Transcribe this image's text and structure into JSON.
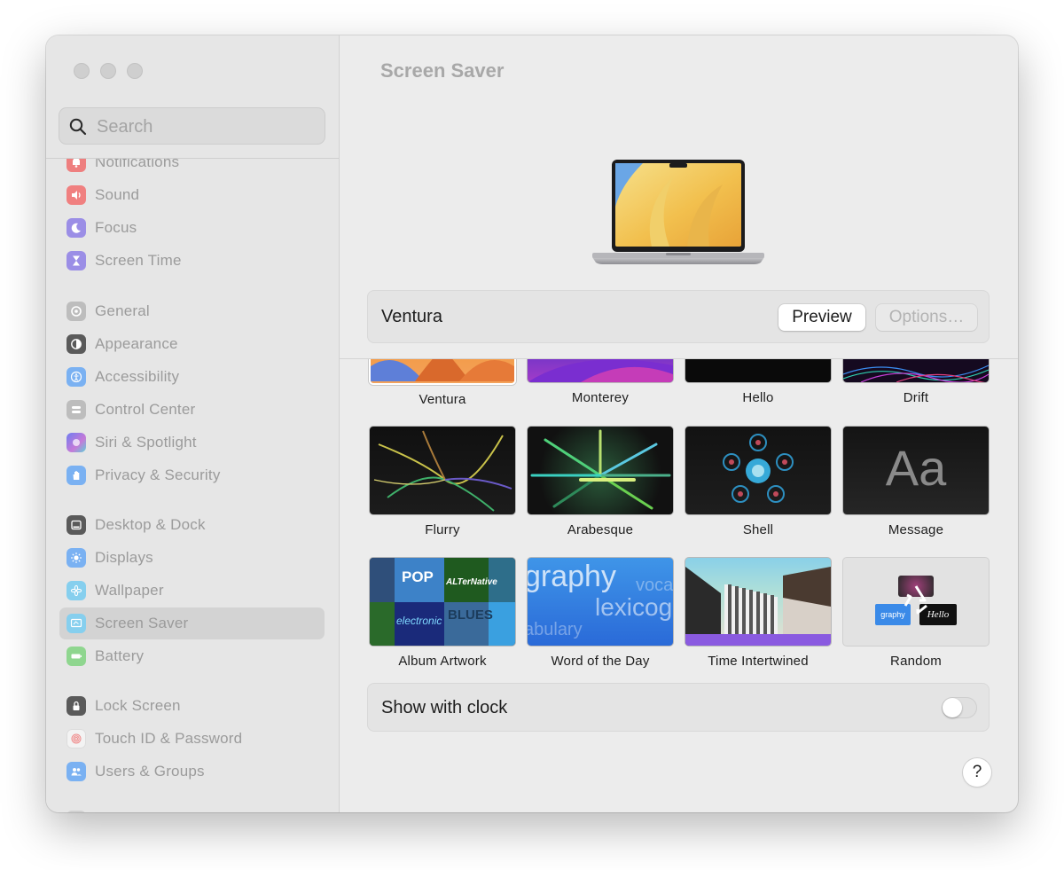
{
  "window": {
    "controls": [
      "close",
      "minimize",
      "zoom"
    ]
  },
  "search": {
    "placeholder": "Search"
  },
  "sidebar": {
    "items": [
      {
        "label": "Notifications",
        "icon": "bell-icon",
        "color": "#ee7f7f"
      },
      {
        "label": "Sound",
        "icon": "speaker-icon",
        "color": "#f08080"
      },
      {
        "label": "Focus",
        "icon": "moon-icon",
        "color": "#9b8ee6"
      },
      {
        "label": "Screen Time",
        "icon": "hourglass-icon",
        "color": "#9b8ee6"
      },
      {
        "label": "General",
        "icon": "gear-icon",
        "color": "#bdbdbd"
      },
      {
        "label": "Appearance",
        "icon": "appearance-icon",
        "color": "#5a5a5a"
      },
      {
        "label": "Accessibility",
        "icon": "accessibility-icon",
        "color": "#7ab1f2"
      },
      {
        "label": "Control Center",
        "icon": "control-center-icon",
        "color": "#bdbdbd"
      },
      {
        "label": "Siri & Spotlight",
        "icon": "siri-icon",
        "color": "#8a7fd6"
      },
      {
        "label": "Privacy & Security",
        "icon": "hand-icon",
        "color": "#7ab1f2"
      },
      {
        "label": "Desktop & Dock",
        "icon": "dock-icon",
        "color": "#5a5a5a"
      },
      {
        "label": "Displays",
        "icon": "sun-icon",
        "color": "#7ab1f2"
      },
      {
        "label": "Wallpaper",
        "icon": "flower-icon",
        "color": "#86cfee"
      },
      {
        "label": "Screen Saver",
        "icon": "screen-saver-icon",
        "color": "#86cfee"
      },
      {
        "label": "Battery",
        "icon": "battery-icon",
        "color": "#8fd68f"
      },
      {
        "label": "Lock Screen",
        "icon": "lock-icon",
        "color": "#5a5a5a"
      },
      {
        "label": "Touch ID & Password",
        "icon": "fingerprint-icon",
        "color": "#f3f3f3"
      },
      {
        "label": "Users & Groups",
        "icon": "users-icon",
        "color": "#7ab1f2"
      }
    ],
    "selected": "Screen Saver"
  },
  "main": {
    "title": "Screen Saver",
    "current_saver": "Ventura",
    "preview_label": "Preview",
    "options_label": "Options…",
    "savers": [
      {
        "label": "Ventura",
        "selected": true
      },
      {
        "label": "Monterey"
      },
      {
        "label": "Hello"
      },
      {
        "label": "Drift"
      },
      {
        "label": "Flurry"
      },
      {
        "label": "Arabesque"
      },
      {
        "label": "Shell"
      },
      {
        "label": "Message",
        "thumb_text": "Aa"
      },
      {
        "label": "Album Artwork",
        "thumb_words": [
          "BLUES",
          "POP",
          "ALTerNative",
          "electronic"
        ]
      },
      {
        "label": "Word of the Day",
        "thumb_words": [
          "graphy",
          "voca",
          "lexicog",
          "abulary"
        ]
      },
      {
        "label": "Time Intertwined"
      },
      {
        "label": "Random",
        "thumb_words": [
          "graphy",
          "Hello"
        ]
      }
    ],
    "show_with_clock_label": "Show with clock",
    "show_with_clock": false,
    "help_label": "?"
  }
}
